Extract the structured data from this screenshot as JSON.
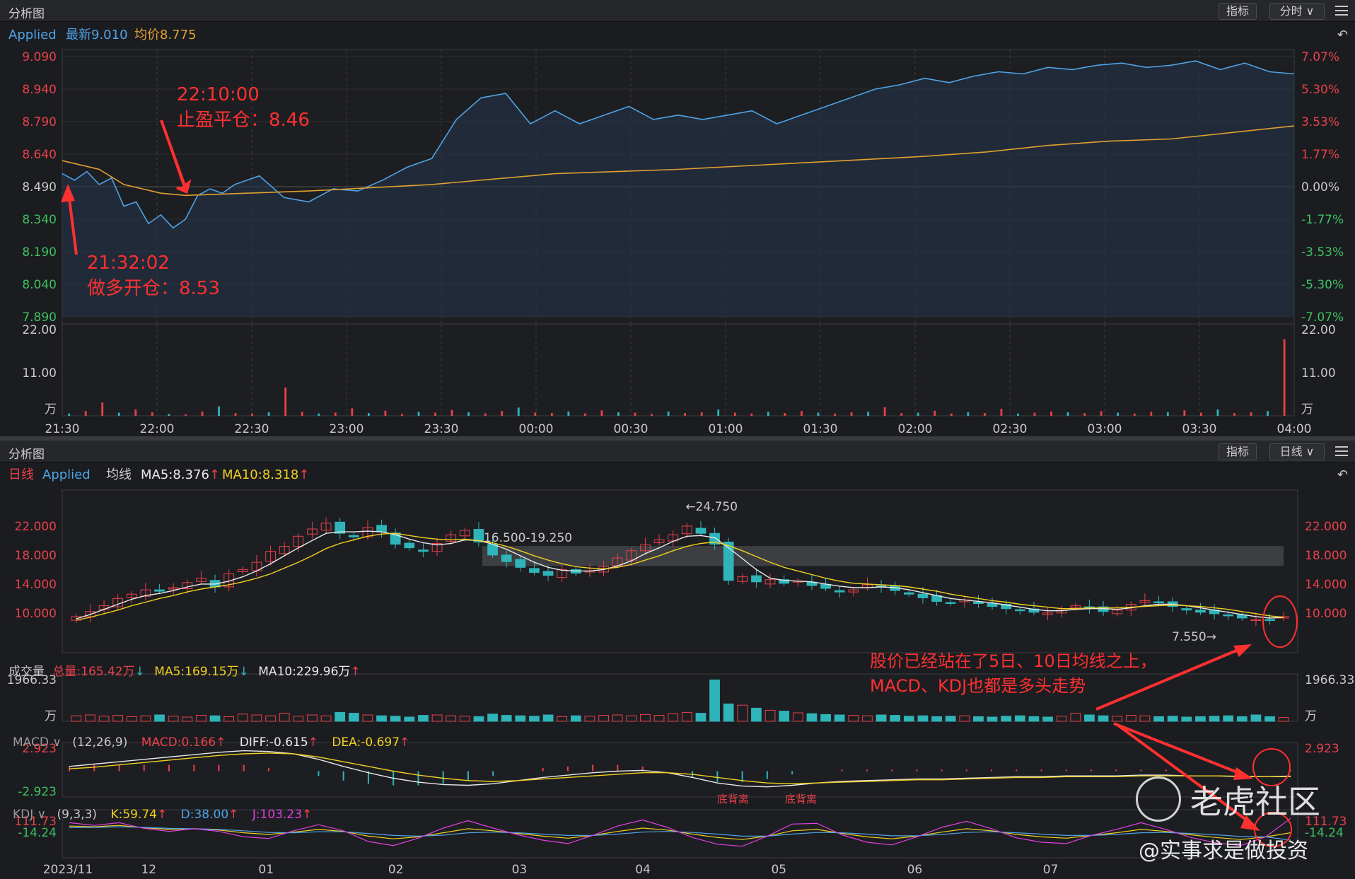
{
  "top_panel": {
    "title": "分析图",
    "btn_indicator": "指标",
    "btn_period": "分时 ∨",
    "info": {
      "name": "Applied",
      "last": "最新9.010",
      "avg": "均价8.775"
    },
    "annotations": [
      {
        "time": "22:10:00",
        "text": "止盈平仓：8.46"
      },
      {
        "time": "21:32:02",
        "text": "做多开仓：8.53"
      }
    ]
  },
  "bottom_panel": {
    "title": "分析图",
    "btn_indicator": "指标",
    "btn_period": "日线 ∨",
    "info": {
      "period": "日线",
      "name": "Applied",
      "ma_label": "均线",
      "ma5": "MA5:8.376",
      "ma10": "MA10:8.318"
    },
    "volume_info": {
      "label": "成交量",
      "total": "总量:165.42万",
      "ma5": "MA5:169.15万",
      "ma10": "MA10:229.96万"
    },
    "macd_info": {
      "label": "MACD ∨",
      "params": "(12,26,9)",
      "macd": "MACD:0.166",
      "diff": "DIFF:-0.615",
      "dea": "DEA:-0.697"
    },
    "kdj_info": {
      "label": "KDJ ∨",
      "params": "(9,3,3)",
      "k": "K:59.74",
      "d": "D:38.00",
      "j": "J:103.23"
    },
    "comment_line1": "股价已经站在了5日、10日均线之上，",
    "comment_line2": "MACD、KDJ也都是多头走势",
    "divergence_label_1": "底背离",
    "divergence_label_2": "底背离",
    "high_marker": "←24.750",
    "low_marker": "7.550→",
    "range_marker": "16.500-19.250"
  },
  "watermark": {
    "brand": "老虎社区",
    "author": "@实事求是做投资"
  },
  "colors": {
    "up": "#e8414a",
    "down": "#2fb5b9",
    "price_line": "#4ea3e6",
    "avg_line": "#e0a030",
    "annotation": "#ff3030"
  },
  "chart_data": [
    {
      "type": "line",
      "title": "",
      "x": [
        "21:30",
        "22:00",
        "22:30",
        "23:00",
        "23:30",
        "00:00",
        "00:30",
        "01:00",
        "01:30",
        "02:00",
        "02:30",
        "03:00",
        "03:30",
        "04:00"
      ],
      "y_axis_left": [
        "9.090",
        "8.940",
        "8.790",
        "8.640",
        "8.490",
        "8.340",
        "8.190",
        "8.040",
        "7.890"
      ],
      "y_axis_right": [
        "7.07%",
        "5.30%",
        "3.53%",
        "1.77%",
        "0.00%",
        "-1.77%",
        "-3.53%",
        "-5.30%",
        "-7.07%"
      ],
      "ylim": [
        7.89,
        9.09
      ],
      "base_price": 8.49,
      "series": [
        {
          "name": "最新",
          "time_frac": [
            0,
            0.01,
            0.02,
            0.03,
            0.04,
            0.05,
            0.06,
            0.07,
            0.08,
            0.09,
            0.1,
            0.11,
            0.12,
            0.13,
            0.14,
            0.16,
            0.18,
            0.2,
            0.22,
            0.24,
            0.26,
            0.28,
            0.3,
            0.32,
            0.34,
            0.36,
            0.38,
            0.4,
            0.42,
            0.44,
            0.46,
            0.48,
            0.5,
            0.52,
            0.54,
            0.56,
            0.58,
            0.6,
            0.62,
            0.64,
            0.66,
            0.68,
            0.7,
            0.72,
            0.74,
            0.76,
            0.78,
            0.8,
            0.82,
            0.84,
            0.86,
            0.88,
            0.9,
            0.92,
            0.94,
            0.96,
            0.98,
            1.0
          ],
          "values": [
            8.55,
            8.52,
            8.56,
            8.5,
            8.53,
            8.4,
            8.42,
            8.32,
            8.36,
            8.3,
            8.34,
            8.45,
            8.48,
            8.46,
            8.5,
            8.54,
            8.44,
            8.42,
            8.48,
            8.47,
            8.52,
            8.58,
            8.62,
            8.8,
            8.9,
            8.92,
            8.78,
            8.84,
            8.78,
            8.82,
            8.86,
            8.8,
            8.82,
            8.8,
            8.82,
            8.84,
            8.78,
            8.82,
            8.86,
            8.9,
            8.94,
            8.96,
            8.99,
            8.97,
            9.0,
            9.02,
            9.01,
            9.04,
            9.03,
            9.05,
            9.06,
            9.04,
            9.05,
            9.07,
            9.03,
            9.06,
            9.02,
            9.01
          ]
        },
        {
          "name": "均价",
          "time_frac": [
            0,
            0.03,
            0.05,
            0.08,
            0.1,
            0.15,
            0.2,
            0.3,
            0.4,
            0.5,
            0.6,
            0.7,
            0.75,
            0.8,
            0.85,
            0.9,
            0.95,
            1.0
          ],
          "values": [
            8.61,
            8.57,
            8.5,
            8.46,
            8.45,
            8.46,
            8.47,
            8.5,
            8.55,
            8.57,
            8.6,
            8.63,
            8.65,
            8.68,
            8.7,
            8.71,
            8.74,
            8.77
          ]
        }
      ]
    },
    {
      "type": "bar",
      "title": "",
      "y_axis": [
        "22.00",
        "11.00",
        "万"
      ],
      "ylim": [
        0,
        22
      ],
      "series": [
        {
          "name": "成交量",
          "values": [
            0.6,
            1.2,
            3.4,
            0.8,
            1.6,
            0.9,
            0.5,
            0.4,
            1.1,
            2.4,
            0.7,
            0.6,
            0.9,
            7.2,
            1.0,
            0.6,
            0.8,
            1.9,
            0.7,
            1.3,
            0.5,
            1.0,
            0.8,
            1.5,
            0.9,
            0.6,
            1.2,
            2.1,
            0.8,
            0.7,
            1.1,
            0.6,
            1.4,
            0.9,
            0.8,
            0.5,
            1.1,
            0.7,
            0.9,
            1.6,
            0.8,
            0.6,
            1.0,
            0.7,
            1.2,
            0.8,
            0.6,
            0.9,
            1.0,
            2.2,
            0.7,
            0.8,
            1.3,
            0.6,
            0.9,
            0.7,
            1.8,
            0.6,
            0.8,
            1.1,
            0.9,
            0.7,
            1.2,
            0.8,
            0.6,
            1.0,
            0.9,
            1.4,
            0.8,
            1.6,
            0.7,
            0.9,
            1.2,
            19.5
          ]
        }
      ]
    },
    {
      "type": "candlestick",
      "title": "",
      "x": [
        "2023/11",
        "12",
        "01",
        "02",
        "03",
        "04",
        "05",
        "06",
        "07"
      ],
      "y_axis": [
        "22.000",
        "18.000",
        "14.000",
        "10.000"
      ],
      "ylim": [
        5.0,
        26.0
      ],
      "series": [
        {
          "name": "close",
          "values": [
            9.5,
            10.2,
            11.0,
            12.0,
            12.6,
            13.2,
            13.0,
            13.5,
            14.2,
            14.8,
            13.6,
            15.4,
            16.0,
            17.0,
            18.5,
            19.2,
            20.6,
            21.6,
            22.4,
            21.0,
            20.5,
            21.8,
            21.2,
            19.5,
            19.0,
            18.5,
            19.6,
            20.8,
            21.4,
            19.8,
            18.0,
            17.1,
            16.3,
            15.6,
            15.2,
            16.0,
            15.5,
            15.8,
            16.4,
            17.6,
            18.6,
            19.4,
            20.1,
            20.8,
            22.0,
            21.0,
            19.5,
            14.5,
            15.0,
            14.3,
            14.6,
            14.1,
            14.4,
            13.8,
            13.4,
            12.9,
            13.2,
            13.9,
            13.6,
            13.1,
            12.6,
            12.1,
            11.6,
            11.4,
            11.8,
            11.3,
            10.9,
            10.6,
            10.4,
            10.1,
            10.0,
            10.4,
            11.0,
            10.7,
            10.2,
            10.4,
            11.2,
            11.7,
            11.4,
            10.9,
            10.4,
            10.1,
            9.9,
            9.6,
            9.3,
            9.1,
            9.0,
            9.5
          ]
        },
        {
          "name": "MA5",
          "values": [
            9.2,
            9.8,
            10.5,
            11.2,
            11.9,
            12.4,
            12.7,
            13.1,
            13.6,
            14.0,
            14.0,
            14.4,
            15.0,
            15.8,
            16.8,
            17.9,
            19.0,
            20.0,
            21.0,
            21.2,
            21.2,
            21.3,
            21.2,
            20.8,
            20.2,
            19.7,
            19.4,
            19.6,
            20.1,
            20.0,
            19.5,
            18.8,
            17.9,
            17.0,
            16.3,
            15.9,
            15.8,
            15.8,
            16.0,
            16.5,
            17.2,
            18.2,
            19.0,
            19.9,
            20.6,
            20.7,
            20.4,
            19.0,
            17.5,
            16.0,
            14.8,
            14.5,
            14.4,
            14.3,
            14.0,
            13.7,
            13.5,
            13.5,
            13.6,
            13.5,
            13.2,
            12.8,
            12.4,
            12.0,
            11.8,
            11.6,
            11.4,
            11.1,
            10.8,
            10.5,
            10.3,
            10.3,
            10.5,
            10.6,
            10.6,
            10.5,
            10.7,
            11.0,
            11.2,
            11.2,
            11.0,
            10.7,
            10.4,
            10.1,
            9.8,
            9.5,
            9.3,
            9.4
          ]
        },
        {
          "name": "MA10",
          "values": [
            9.0,
            9.4,
            9.9,
            10.4,
            11.0,
            11.5,
            12.0,
            12.4,
            12.9,
            13.3,
            13.6,
            13.9,
            14.3,
            14.8,
            15.4,
            16.2,
            17.0,
            17.9,
            18.9,
            19.6,
            20.1,
            20.6,
            20.9,
            21.0,
            20.7,
            20.4,
            20.2,
            20.1,
            20.2,
            20.0,
            19.7,
            19.2,
            18.6,
            17.9,
            17.3,
            16.8,
            16.4,
            16.2,
            16.1,
            16.3,
            16.7,
            17.3,
            17.9,
            18.6,
            19.2,
            19.6,
            19.8,
            19.3,
            18.6,
            17.8,
            17.0,
            16.3,
            15.8,
            15.3,
            14.8,
            14.4,
            14.1,
            14.0,
            13.9,
            13.8,
            13.6,
            13.3,
            13.0,
            12.6,
            12.3,
            12.0,
            11.7,
            11.5,
            11.2,
            11.0,
            10.8,
            10.6,
            10.6,
            10.7,
            10.7,
            10.7,
            10.8,
            10.9,
            11.0,
            11.1,
            11.0,
            10.9,
            10.7,
            10.5,
            10.2,
            9.9,
            9.6,
            9.4
          ]
        }
      ]
    },
    {
      "type": "bar",
      "title": "",
      "y_axis": [
        "1966.33",
        "万"
      ],
      "ylim": [
        0,
        1966.33
      ],
      "series": [
        {
          "name": "成交量",
          "values": [
            260,
            300,
            240,
            280,
            220,
            260,
            300,
            240,
            200,
            280,
            260,
            220,
            340,
            300,
            260,
            380,
            240,
            300,
            260,
            420,
            380,
            300,
            260,
            240,
            200,
            280,
            300,
            260,
            240,
            220,
            340,
            280,
            260,
            240,
            300,
            220,
            260,
            240,
            280,
            300,
            260,
            320,
            280,
            360,
            420,
            380,
            1950,
            820,
            760,
            620,
            520,
            480,
            400,
            360,
            320,
            300,
            280,
            260,
            300,
            280,
            240,
            260,
            220,
            240,
            260,
            220,
            200,
            240,
            260,
            220,
            200,
            240,
            380,
            300,
            260,
            240,
            280,
            260,
            220,
            240,
            200,
            220,
            240,
            260,
            220,
            300,
            220,
            180
          ]
        }
      ]
    },
    {
      "type": "line",
      "title": "",
      "y_axis": [
        "2.923",
        "-2.923"
      ],
      "ylim": [
        -2.923,
        2.923
      ],
      "series": [
        {
          "name": "DIFF",
          "values": [
            0.6,
            0.9,
            1.2,
            1.5,
            1.8,
            2.1,
            2.4,
            2.6,
            2.5,
            2.2,
            1.5,
            0.6,
            -0.2,
            -0.9,
            -1.4,
            -1.7,
            -1.8,
            -1.6,
            -1.2,
            -0.8,
            -0.5,
            -0.2,
            0.0,
            0.1,
            -0.2,
            -0.8,
            -1.5,
            -1.9,
            -2.0,
            -1.8,
            -1.5,
            -1.3,
            -1.2,
            -1.1,
            -1.0,
            -1.0,
            -0.9,
            -0.8,
            -0.7,
            -0.7,
            -0.6,
            -0.6,
            -0.6,
            -0.5,
            -0.5,
            -0.6,
            -0.6,
            -0.7,
            -0.7,
            -0.62
          ]
        },
        {
          "name": "DEA",
          "values": [
            0.3,
            0.5,
            0.8,
            1.1,
            1.4,
            1.7,
            2.0,
            2.2,
            2.3,
            2.2,
            1.8,
            1.2,
            0.6,
            0.0,
            -0.5,
            -0.9,
            -1.2,
            -1.3,
            -1.2,
            -1.0,
            -0.8,
            -0.6,
            -0.4,
            -0.2,
            -0.2,
            -0.4,
            -0.8,
            -1.2,
            -1.5,
            -1.6,
            -1.5,
            -1.4,
            -1.3,
            -1.2,
            -1.1,
            -1.1,
            -1.0,
            -0.9,
            -0.8,
            -0.8,
            -0.7,
            -0.7,
            -0.7,
            -0.6,
            -0.6,
            -0.6,
            -0.6,
            -0.65,
            -0.7,
            -0.7
          ]
        }
      ]
    },
    {
      "type": "line",
      "title": "",
      "y_axis": [
        "111.73",
        "-14.24"
      ],
      "ylim": [
        -14.24,
        111.73
      ],
      "series": [
        {
          "name": "K",
          "values": [
            80,
            78,
            82,
            75,
            70,
            72,
            68,
            60,
            55,
            62,
            70,
            64,
            50,
            42,
            48,
            60,
            72,
            66,
            58,
            50,
            44,
            52,
            64,
            74,
            68,
            56,
            46,
            40,
            50,
            66,
            70,
            58,
            48,
            42,
            50,
            62,
            72,
            66,
            55,
            48,
            44,
            52,
            60,
            70,
            64,
            54,
            46,
            40,
            48,
            60
          ]
        },
        {
          "name": "D",
          "values": [
            75,
            76,
            78,
            76,
            73,
            72,
            70,
            66,
            61,
            60,
            63,
            63,
            58,
            52,
            50,
            53,
            60,
            62,
            60,
            56,
            52,
            52,
            56,
            62,
            64,
            61,
            56,
            50,
            50,
            56,
            61,
            60,
            56,
            51,
            51,
            55,
            61,
            63,
            60,
            56,
            52,
            52,
            55,
            60,
            61,
            58,
            54,
            49,
            48,
            38
          ]
        },
        {
          "name": "J",
          "values": [
            90,
            82,
            90,
            73,
            64,
            72,
            64,
            48,
            43,
            66,
            84,
            66,
            34,
            22,
            44,
            74,
            96,
            74,
            54,
            38,
            28,
            52,
            80,
            98,
            76,
            46,
            26,
            20,
            50,
            86,
            88,
            54,
            32,
            24,
            48,
            76,
            94,
            72,
            45,
            32,
            28,
            52,
            70,
            90,
            70,
            46,
            30,
            22,
            48,
            103
          ]
        }
      ]
    }
  ]
}
